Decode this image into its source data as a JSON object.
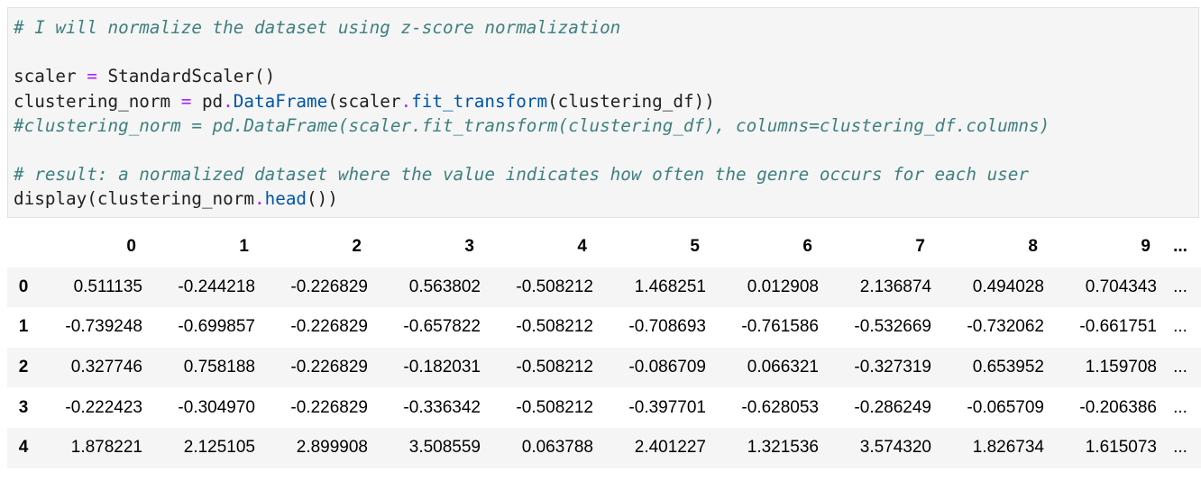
{
  "code_cell": {
    "lines": [
      [
        {
          "t": "# I will normalize the dataset using z-score normalization",
          "k": "c"
        }
      ],
      [],
      [
        {
          "t": "scaler "
        },
        {
          "t": "=",
          "k": "op"
        },
        {
          "t": " StandardScaler()"
        }
      ],
      [
        {
          "t": "clustering_norm "
        },
        {
          "t": "=",
          "k": "op"
        },
        {
          "t": " pd"
        },
        {
          "t": ".",
          "k": "op"
        },
        {
          "t": "DataFrame",
          "k": "attr"
        },
        {
          "t": "(scaler"
        },
        {
          "t": ".",
          "k": "op"
        },
        {
          "t": "fit_transform",
          "k": "attr"
        },
        {
          "t": "(clustering_df))"
        }
      ],
      [
        {
          "t": "#clustering_norm = pd.DataFrame(scaler.fit_transform(clustering_df), columns=clustering_df.columns)",
          "k": "c"
        }
      ],
      [],
      [
        {
          "t": "# result: a normalized dataset where the value indicates how often the genre occurs for each user",
          "k": "c"
        }
      ],
      [
        {
          "t": "display(clustering_norm"
        },
        {
          "t": ".",
          "k": "op"
        },
        {
          "t": "head",
          "k": "attr"
        },
        {
          "t": "())"
        }
      ]
    ]
  },
  "output_table": {
    "columns": [
      "0",
      "1",
      "2",
      "3",
      "4",
      "5",
      "6",
      "7",
      "8",
      "9",
      "..."
    ],
    "rows": [
      {
        "index": "0",
        "values": [
          "0.511135",
          "-0.244218",
          "-0.226829",
          "0.563802",
          "-0.508212",
          "1.468251",
          "0.012908",
          "2.136874",
          "0.494028",
          "0.704343",
          "..."
        ]
      },
      {
        "index": "1",
        "values": [
          "-0.739248",
          "-0.699857",
          "-0.226829",
          "-0.657822",
          "-0.508212",
          "-0.708693",
          "-0.761586",
          "-0.532669",
          "-0.732062",
          "-0.661751",
          "..."
        ]
      },
      {
        "index": "2",
        "values": [
          "0.327746",
          "0.758188",
          "-0.226829",
          "-0.182031",
          "-0.508212",
          "-0.086709",
          "0.066321",
          "-0.327319",
          "0.653952",
          "1.159708",
          "..."
        ]
      },
      {
        "index": "3",
        "values": [
          "-0.222423",
          "-0.304970",
          "-0.226829",
          "-0.336342",
          "-0.508212",
          "-0.397701",
          "-0.628053",
          "-0.286249",
          "-0.065709",
          "-0.206386",
          "..."
        ]
      },
      {
        "index": "4",
        "values": [
          "1.878221",
          "2.125105",
          "2.899908",
          "3.508559",
          "0.063788",
          "2.401227",
          "1.321536",
          "3.574320",
          "1.826734",
          "1.615073",
          "..."
        ]
      }
    ]
  }
}
